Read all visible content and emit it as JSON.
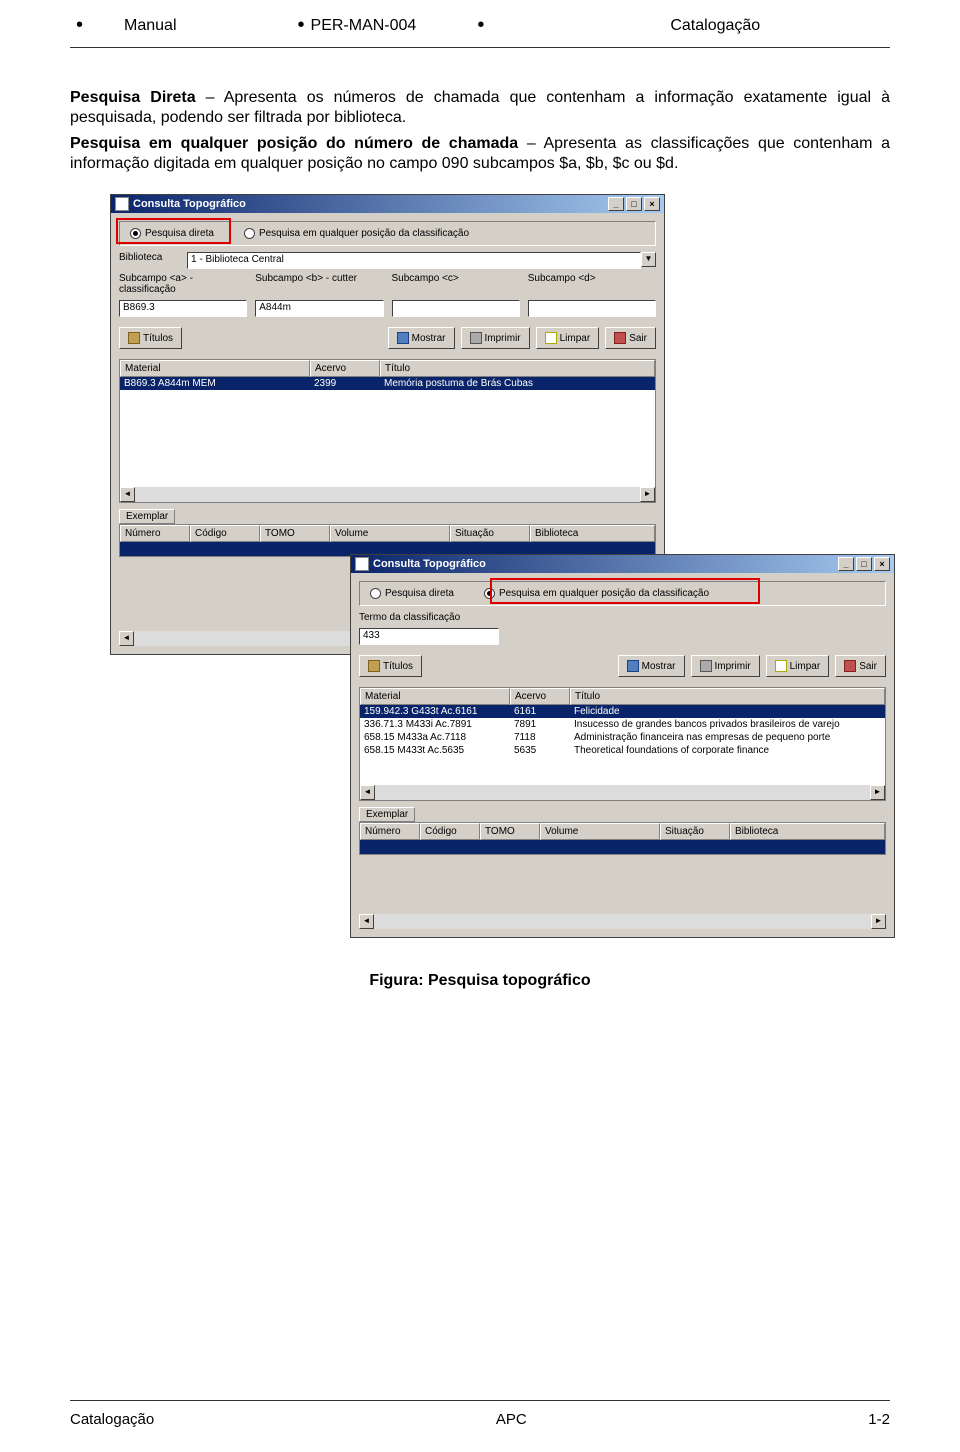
{
  "header": {
    "col1": "Manual",
    "col2": "PER-MAN-004",
    "col3": "Catalogação"
  },
  "para1": {
    "bold": "Pesquisa Direta",
    "rest": " – Apresenta os números de chamada que contenham a informação exatamente igual à pesquisada, podendo ser filtrada por biblioteca."
  },
  "para2": {
    "bold": "Pesquisa em qualquer posição do número de chamada",
    "rest": " – Apresenta as classificações que contenham a informação digitada em qualquer posição no campo 090 subcampos $a, $b, $c ou $d."
  },
  "win1": {
    "title": "Consulta Topográfico",
    "radio1": "Pesquisa direta",
    "radio2": "Pesquisa em qualquer posição da classificação",
    "biblioteca_lbl": "Biblioteca",
    "biblioteca_val": "1 - Biblioteca Central",
    "suba_lbl": "Subcampo <a> - classificação",
    "suba_val": "B869.3",
    "subb_lbl": "Subcampo <b> - cutter",
    "subb_val": "A844m",
    "subc_lbl": "Subcampo <c>",
    "subc_val": "",
    "subd_lbl": "Subcampo <d>",
    "subd_val": "",
    "btn_titulos": "Títulos",
    "btn_mostrar": "Mostrar",
    "btn_imprimir": "Imprimir",
    "btn_limpar": "Limpar",
    "btn_sair": "Sair",
    "grid1_head": {
      "material": "Material",
      "acervo": "Acervo",
      "titulo": "Título"
    },
    "grid1_rows": [
      {
        "material": "B869.3  A844m  MEM",
        "acervo": "2399",
        "titulo": "Memória postuma de Brás Cubas"
      }
    ],
    "exemplar_lbl": "Exemplar",
    "grid2_head": {
      "numero": "Número",
      "codigo": "Código",
      "tomo": "TOMO",
      "volume": "Volume",
      "situacao": "Situação",
      "biblioteca": "Biblioteca"
    }
  },
  "win2": {
    "title": "Consulta Topográfico",
    "radio1": "Pesquisa direta",
    "radio2": "Pesquisa em qualquer posição da classificação",
    "termo_lbl": "Termo da classificação",
    "termo_val": "433",
    "btn_titulos": "Títulos",
    "btn_mostrar": "Mostrar",
    "btn_imprimir": "Imprimir",
    "btn_limpar": "Limpar",
    "btn_sair": "Sair",
    "grid1_head": {
      "material": "Material",
      "acervo": "Acervo",
      "titulo": "Título"
    },
    "grid1_rows": [
      {
        "material": "159.942.3 G433t  Ac.6161",
        "acervo": "6161",
        "titulo": "Felicidade"
      },
      {
        "material": "336.71.3 M433i  Ac.7891",
        "acervo": "7891",
        "titulo": "Insucesso de grandes bancos privados brasileiros de varejo"
      },
      {
        "material": "658.15 M433a  Ac.7118",
        "acervo": "7118",
        "titulo": "Administração financeira nas empresas de pequeno porte"
      },
      {
        "material": "658.15 M433t  Ac.5635",
        "acervo": "5635",
        "titulo": "Theoretical foundations of corporate finance"
      }
    ],
    "exemplar_lbl": "Exemplar",
    "grid2_head": {
      "numero": "Número",
      "codigo": "Código",
      "tomo": "TOMO",
      "volume": "Volume",
      "situacao": "Situação",
      "biblioteca": "Biblioteca"
    }
  },
  "caption": "Figura: Pesquisa topográfico",
  "footer": {
    "left": "Catalogação",
    "center": "APC",
    "right": "1-2"
  }
}
